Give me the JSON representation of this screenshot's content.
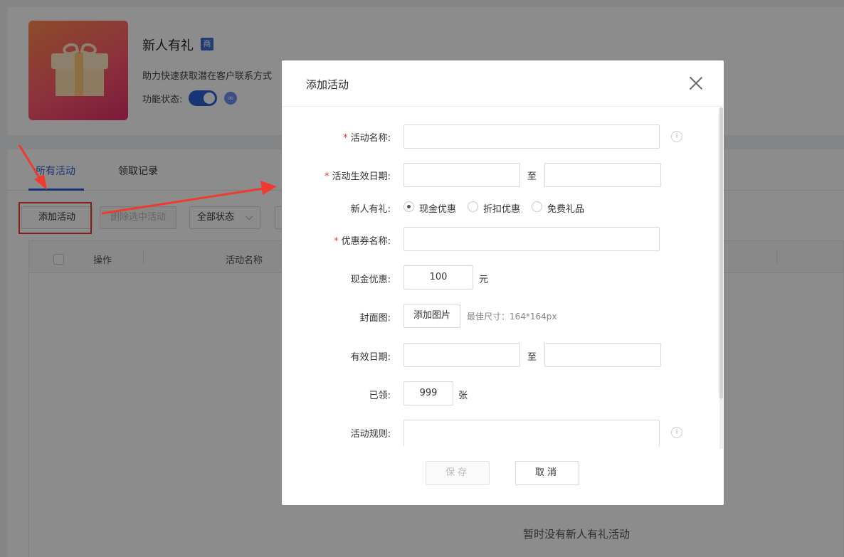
{
  "app": {
    "title": "新人有礼",
    "tag": "商",
    "description": "助力快速获取潜在客户联系方式",
    "status_label": "功能状态:"
  },
  "tabs": [
    {
      "label": "所有活动",
      "active": true
    },
    {
      "label": "领取记录",
      "active": false
    }
  ],
  "toolbar": {
    "add_label": "添加活动",
    "delete_label": "删除选中活动",
    "status_select": "全部状态"
  },
  "table": {
    "columns": [
      "操作",
      "活动名称"
    ],
    "empty_text": "暂时没有新人有礼活动"
  },
  "modal": {
    "title": "添加活动",
    "fields": {
      "activity_name": {
        "label": "活动名称:",
        "required": true,
        "value": ""
      },
      "effective_date": {
        "label": "活动生效日期:",
        "required": true,
        "start": "",
        "end": "",
        "separator": "至"
      },
      "gift_type": {
        "label": "新人有礼:",
        "options": [
          "现金优惠",
          "折扣优惠",
          "免费礼品"
        ],
        "selected": "现金优惠"
      },
      "coupon_name": {
        "label": "优惠券名称:",
        "required": true,
        "value": ""
      },
      "cash_discount": {
        "label": "现金优惠:",
        "value": "100",
        "unit": "元"
      },
      "cover": {
        "label": "封面图:",
        "button": "添加图片",
        "hint": "最佳尺寸：164*164px"
      },
      "valid_date": {
        "label": "有效日期:",
        "start": "",
        "end": "",
        "separator": "至"
      },
      "claimed": {
        "label": "已领:",
        "value": "999",
        "unit": "张"
      },
      "rules": {
        "label": "活动规则:",
        "value": ""
      }
    },
    "buttons": {
      "save": "保存",
      "cancel": "取消"
    }
  },
  "colors": {
    "accent": "#2f5fd6",
    "required": "#f03a2e",
    "annotation": "#f03a2e"
  }
}
